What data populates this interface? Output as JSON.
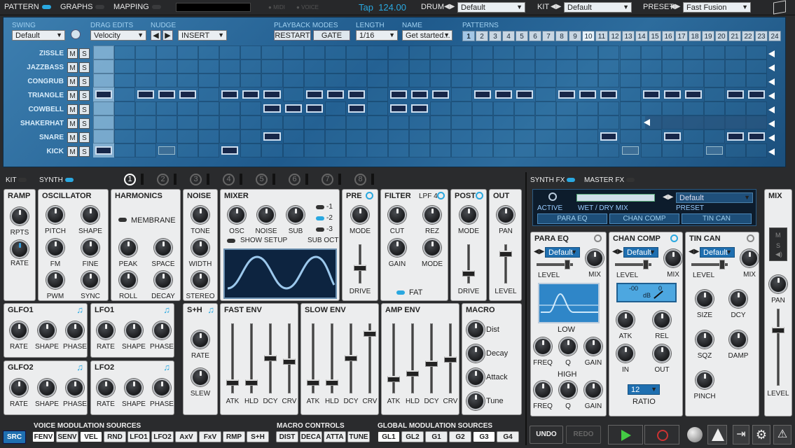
{
  "topbar": {
    "pattern": "PATTERN",
    "graphs": "GRAPHS",
    "mapping": "MAPPING",
    "midi": "MIDI",
    "voice": "VOICE",
    "tap": "Tap",
    "tempo": "124.00",
    "drum": "DRUM",
    "drum_value": "Default",
    "kit": "KIT",
    "kit_value": "Default",
    "preset": "PRESET",
    "preset_value": "Fast Fusion"
  },
  "pattern_header": {
    "swing": "SWING",
    "swing_value": "Default",
    "drag_edits": "DRAG EDITS",
    "drag_value": "Velocity",
    "nudge": "NUDGE",
    "insert": "INSERT",
    "playback_modes": "PLAYBACK MODES",
    "restart": "RESTART",
    "gate": "GATE",
    "length": "LENGTH",
    "length_value": "1/16",
    "name": "NAME",
    "name_value": "Get started...",
    "patterns": "PATTERNS",
    "pattern_numbers": [
      "1",
      "2",
      "3",
      "4",
      "5",
      "6",
      "7",
      "8",
      "9",
      "10",
      "11",
      "12",
      "13",
      "14",
      "15",
      "16",
      "17",
      "18",
      "19",
      "20",
      "21",
      "22",
      "23",
      "24"
    ]
  },
  "tracks": [
    {
      "name": "ZISSLE",
      "m": "M",
      "s": "S"
    },
    {
      "name": "JAZZBASS",
      "m": "M",
      "s": "S"
    },
    {
      "name": "CONGRUB",
      "m": "M",
      "s": "S"
    },
    {
      "name": "TRIANGLE",
      "m": "M",
      "s": "S"
    },
    {
      "name": "COWBELL",
      "m": "M",
      "s": "S"
    },
    {
      "name": "SHAKERHAT",
      "m": "M",
      "s": "S"
    },
    {
      "name": "SNARE",
      "m": "M",
      "s": "S"
    },
    {
      "name": "KICK",
      "m": "M",
      "s": "S"
    }
  ],
  "steps_on": {
    "TRIANGLE": [
      0,
      2,
      3,
      4,
      6,
      7,
      8,
      10,
      11,
      12,
      14,
      15,
      16,
      18,
      19,
      20,
      22,
      23,
      24,
      26,
      27,
      28,
      30,
      31
    ],
    "COWBELL": [
      8,
      9,
      10,
      12,
      14,
      15
    ],
    "SNARE": [
      8,
      24,
      27,
      30,
      31
    ],
    "KICK": [
      0,
      3,
      6,
      25,
      29
    ]
  },
  "tabs": {
    "kit": "KIT",
    "synth": "SYNTH",
    "voices": [
      "1",
      "2",
      "3",
      "4",
      "5",
      "6",
      "7",
      "8"
    ],
    "synth_fx": "SYNTH FX",
    "master_fx": "MASTER FX"
  },
  "ramp": {
    "title": "RAMP",
    "k1": "RPTS",
    "k2": "RATE"
  },
  "oscillator": {
    "title": "OSCILLATOR",
    "k": [
      "PITCH",
      "SHAPE",
      "FM",
      "FINE",
      "PWM",
      "SYNC"
    ]
  },
  "harmonics": {
    "title": "HARMONICS",
    "membrane": "MEMBRANE",
    "k": [
      "PEAK",
      "SPACE",
      "ROLL",
      "DECAY"
    ]
  },
  "noise": {
    "title": "NOISE",
    "k": [
      "TONE",
      "WIDTH",
      "STEREO"
    ]
  },
  "mixer": {
    "title": "MIXER",
    "k": [
      "OSC",
      "NOISE",
      "SUB"
    ],
    "show_setup": "SHOW SETUP",
    "sub_oct": "SUB OCT",
    "oct": [
      "-1",
      "-2",
      "-3"
    ]
  },
  "pre": {
    "title": "PRE",
    "mode": "MODE",
    "drive": "DRIVE"
  },
  "filter": {
    "title": "FILTER",
    "type": "LPF 4",
    "k": [
      "CUT",
      "REZ",
      "GAIN",
      "MODE"
    ],
    "fat": "FAT"
  },
  "post": {
    "title": "POST",
    "mode": "MODE",
    "drive": "DRIVE"
  },
  "out": {
    "title": "OUT",
    "pan": "PAN",
    "level": "LEVEL"
  },
  "glfo1": {
    "title": "GLFO1",
    "k": [
      "RATE",
      "SHAPE",
      "PHASE"
    ]
  },
  "lfo1": {
    "title": "LFO1",
    "k": [
      "RATE",
      "SHAPE",
      "PHASE"
    ]
  },
  "glfo2": {
    "title": "GLFO2",
    "k": [
      "RATE",
      "SHAPE",
      "PHASE"
    ]
  },
  "lfo2": {
    "title": "LFO2",
    "k": [
      "RATE",
      "SHAPE",
      "PHASE"
    ]
  },
  "sh": {
    "title": "S+H",
    "k": [
      "RATE",
      "SLEW"
    ]
  },
  "fast_env": {
    "title": "FAST ENV",
    "f": [
      "ATK",
      "HLD",
      "DCY",
      "CRV"
    ],
    "levels": [
      0.15,
      0.15,
      0.5,
      0.45
    ]
  },
  "slow_env": {
    "title": "SLOW ENV",
    "f": [
      "ATK",
      "HLD",
      "DCY",
      "CRV"
    ],
    "levels": [
      0.15,
      0.15,
      0.5,
      0.85
    ]
  },
  "amp_env": {
    "title": "AMP ENV",
    "f": [
      "ATK",
      "HLD",
      "DCY",
      "CRV"
    ],
    "levels": [
      0.2,
      0.28,
      0.42,
      0.48
    ]
  },
  "macro": {
    "title": "MACRO",
    "items": [
      "Dist",
      "Decay",
      "Attack",
      "Tune"
    ]
  },
  "fx_strip": {
    "active": "ACTIVE",
    "wet_dry": "WET / DRY MIX",
    "preset_label": "PRESET",
    "preset_value": "Default",
    "slots": [
      "PARA EQ",
      "CHAN COMP",
      "TIN CAN"
    ]
  },
  "para_eq": {
    "title": "PARA EQ",
    "preset": "Default",
    "level": "LEVEL",
    "mix": "MIX",
    "low": "LOW",
    "high": "HIGH",
    "k": [
      "FREQ",
      "Q",
      "GAIN"
    ]
  },
  "chan_comp": {
    "title": "CHAN COMP",
    "preset": "Default",
    "level": "LEVEL",
    "mix": "MIX",
    "meter_db": "dB",
    "meter_left": "-00",
    "meter_right": "0",
    "k": [
      "ATK",
      "REL",
      "IN",
      "OUT"
    ],
    "ratio_value": "12",
    "ratio": "RATIO"
  },
  "tin_can": {
    "title": "TIN CAN",
    "preset": "Default",
    "level": "LEVEL",
    "mix": "MIX",
    "k": [
      "SIZE",
      "DCY",
      "SQZ",
      "DAMP",
      "PINCH"
    ]
  },
  "mix": {
    "title": "MIX",
    "m": "M",
    "s": "S",
    "pan": "PAN",
    "level": "LEVEL"
  },
  "bottom": {
    "src": "SRC",
    "voice_mod": "VOICE MODULATION SOURCES",
    "voice_buttons": [
      "FENV",
      "SENV",
      "VEL",
      "RND",
      "LFO1",
      "LFO2",
      "AxV",
      "FxV",
      "RMP",
      "S+H"
    ],
    "macro_controls": "MACRO CONTROLS",
    "macro_buttons": [
      "DIST",
      "DECA",
      "ATTA",
      "TUNE"
    ],
    "global_mod": "GLOBAL MODULATION SOURCES",
    "global_buttons": [
      "GL1",
      "GL2",
      "G1",
      "G2",
      "G3",
      "G4"
    ],
    "undo": "UNDO",
    "redo": "REDO"
  }
}
